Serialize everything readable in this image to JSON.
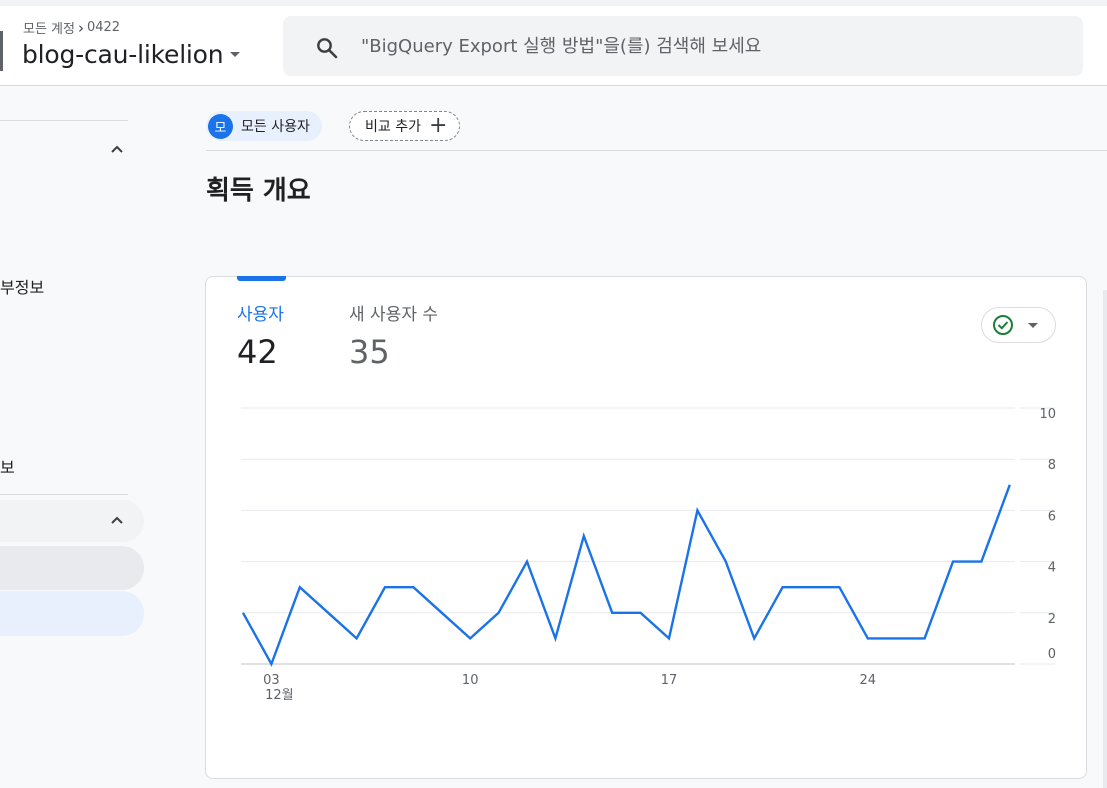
{
  "header": {
    "breadcrumb_account": "모든 계정",
    "breadcrumb_id": "0422",
    "property_name": "blog-cau-likelion",
    "search_placeholder": "\"BigQuery Export 실행 방법\"을(를) 검색해 보세요"
  },
  "sidebar": {
    "item_partial_1": "부정보",
    "item_partial_2": "보"
  },
  "comparison": {
    "segment_avatar": "모",
    "segment_label": "모든 사용자",
    "add_compare_label": "비교 추가"
  },
  "page": {
    "title": "획득 개요"
  },
  "card": {
    "metric_users_label": "사용자",
    "metric_users_value": "42",
    "metric_new_users_label": "새 사용자 수",
    "metric_new_users_value": "35",
    "status_icon": "check-circle-icon"
  },
  "colors": {
    "accent": "#1a73e8",
    "status_ok": "#188038"
  },
  "chart_data": {
    "type": "line",
    "x": [
      2,
      3,
      4,
      5,
      6,
      7,
      8,
      9,
      10,
      11,
      12,
      13,
      14,
      15,
      16,
      17,
      18,
      19,
      20,
      21,
      22,
      23,
      24,
      25,
      26,
      27,
      28,
      29,
      30
    ],
    "series": [
      {
        "values": [
          2,
          0,
          3,
          2,
          1,
          3,
          3,
          2,
          1,
          2,
          4,
          1,
          5,
          2,
          2,
          1,
          6,
          4,
          1,
          3,
          3,
          3,
          1,
          1,
          1,
          4,
          4,
          7
        ]
      }
    ],
    "x_ticks": [
      {
        "value": 3,
        "label": "03",
        "sublabel": "12월"
      },
      {
        "value": 10,
        "label": "10"
      },
      {
        "value": 17,
        "label": "17"
      },
      {
        "value": 24,
        "label": "24"
      }
    ],
    "y_ticks": [
      0,
      2,
      4,
      6,
      8,
      10
    ],
    "ylim": [
      0,
      10
    ],
    "grid": true,
    "color": "#1a73e8"
  }
}
